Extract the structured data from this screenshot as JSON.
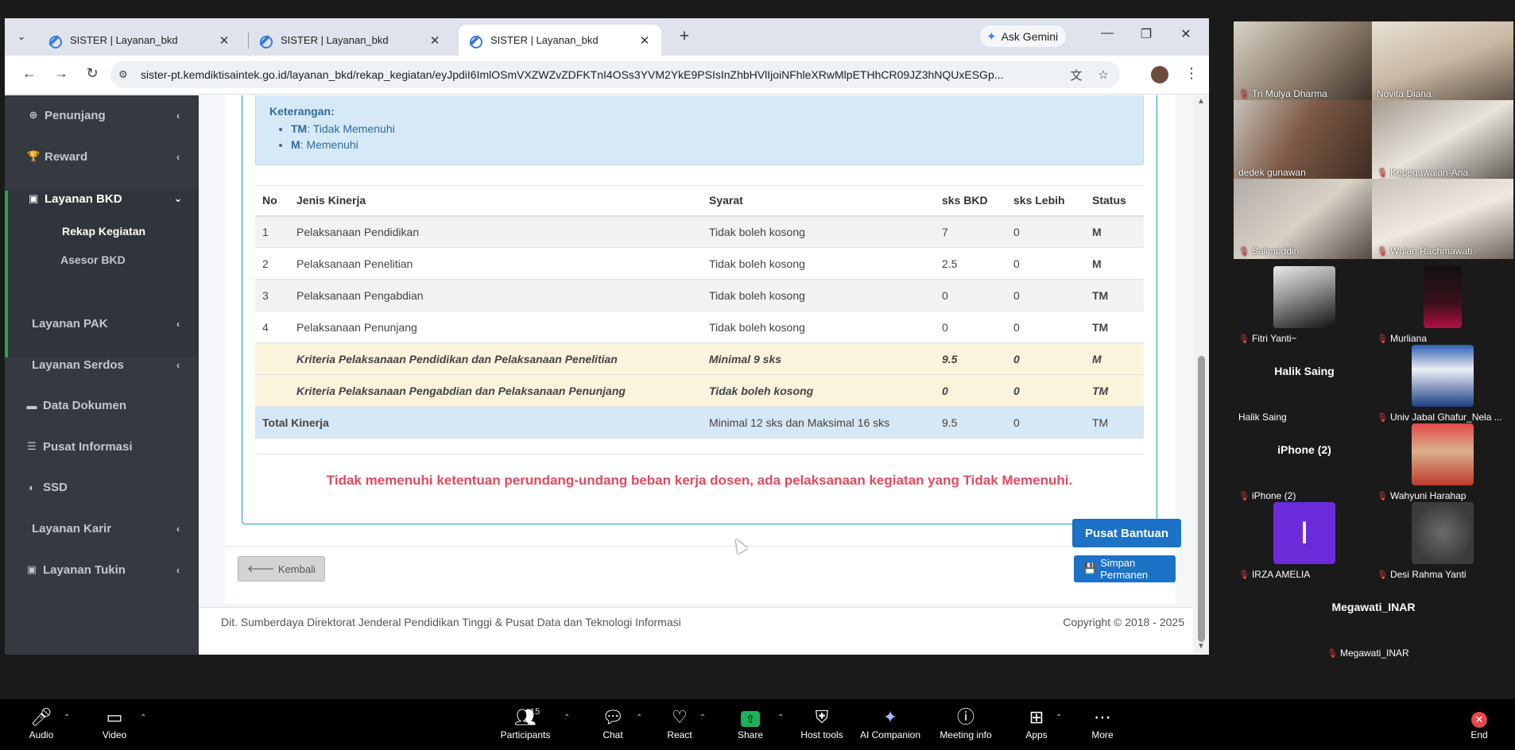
{
  "browser": {
    "tabs": [
      {
        "title": "SISTER | Layanan_bkd",
        "active": false
      },
      {
        "title": "SISTER | Layanan_bkd",
        "active": false
      },
      {
        "title": "SISTER | Layanan_bkd",
        "active": true
      }
    ],
    "ask_gemini": "Ask Gemini",
    "url": "sister-pt.kemdiktisaintek.go.id/layanan_bkd/rekap_kegiatan/eyJpdiI6ImlOSmVXZWZvZDFKTnI4OSs3YVM2YkE9PSIsInZhbHVlIjoiNFhleXRwMlpETHhCR09JZ3hNQUxESGp..."
  },
  "sidebar": {
    "items": [
      {
        "label": "Penunjang",
        "icon": "globe-icon",
        "chevron": "‹"
      },
      {
        "label": "Reward",
        "icon": "trophy-icon",
        "chevron": "‹"
      },
      {
        "label": "Layanan BKD",
        "icon": "briefcase-icon",
        "chevron": "⌄"
      },
      {
        "label": "Layanan PAK",
        "icon": "",
        "chevron": "‹"
      },
      {
        "label": "Layanan Serdos",
        "icon": "",
        "chevron": "‹"
      },
      {
        "label": "Data Dokumen",
        "icon": "folder-icon",
        "chevron": ""
      },
      {
        "label": "Pusat Informasi",
        "icon": "list-icon",
        "chevron": ""
      },
      {
        "label": "SSD",
        "icon": "circle-half-icon",
        "chevron": ""
      },
      {
        "label": "Layanan Karir",
        "icon": "",
        "chevron": "‹"
      },
      {
        "label": "Layanan Tukin",
        "icon": "briefcase-icon",
        "chevron": "‹"
      }
    ],
    "sub": [
      {
        "label": "Rekap Kegiatan"
      },
      {
        "label": "Asesor BKD"
      }
    ]
  },
  "keterangan": {
    "title": "Keterangan:",
    "items": [
      {
        "code": "TM",
        "desc": ": Tidak Memenuhi"
      },
      {
        "code": "M",
        "desc": ": Memenuhi"
      }
    ]
  },
  "table": {
    "headers": [
      "No",
      "Jenis Kinerja",
      "Syarat",
      "sks BKD",
      "sks Lebih",
      "Status"
    ],
    "rows": [
      {
        "no": "1",
        "jenis": "Pelaksanaan Pendidikan",
        "syarat": "Tidak boleh kosong",
        "bkd": "7",
        "lebih": "0",
        "status": "M"
      },
      {
        "no": "2",
        "jenis": "Pelaksanaan Penelitian",
        "syarat": "Tidak boleh kosong",
        "bkd": "2.5",
        "lebih": "0",
        "status": "M"
      },
      {
        "no": "3",
        "jenis": "Pelaksanaan Pengabdian",
        "syarat": "Tidak boleh kosong",
        "bkd": "0",
        "lebih": "0",
        "status": "TM"
      },
      {
        "no": "4",
        "jenis": "Pelaksanaan Penunjang",
        "syarat": "Tidak boleh kosong",
        "bkd": "0",
        "lebih": "0",
        "status": "TM"
      },
      {
        "no": "",
        "jenis": "Kriteria Pelaksanaan Pendidikan dan Pelaksanaan Penelitian",
        "syarat": "Minimal 9 sks",
        "bkd": "9.5",
        "lebih": "0",
        "status": "M"
      },
      {
        "no": "",
        "jenis": "Kriteria Pelaksanaan Pengabdian dan Pelaksanaan Penunjang",
        "syarat": "Tidak boleh kosong",
        "bkd": "0",
        "lebih": "0",
        "status": "TM"
      }
    ],
    "total": {
      "label": "Total Kinerja",
      "syarat": "Minimal 12 sks dan Maksimal 16 sks",
      "bkd": "9.5",
      "lebih": "0",
      "status": "TM"
    }
  },
  "warning": "Tidak memenuhi ketentuan perundang-undang beban kerja dosen, ada pelaksanaan kegiatan yang Tidak Memenuhi.",
  "buttons": {
    "back": "Kembali",
    "save": "Simpan Permanen",
    "help": "Pusat Bantuan"
  },
  "footer": {
    "left": "Dit. Sumberdaya Direktorat Jenderal Pendidikan Tinggi & Pusat Data dan Teknologi Informasi",
    "right": "Copyright © 2018 - 2025"
  },
  "participants": [
    {
      "name": "Tri Mulya Dharma",
      "muted": true,
      "type": "video"
    },
    {
      "name": "Novita Diana",
      "muted": false,
      "type": "video"
    },
    {
      "name": "dedek gunawan",
      "muted": false,
      "type": "video"
    },
    {
      "name": "Kepegawaian-Ana",
      "muted": true,
      "type": "video"
    },
    {
      "name": "Salimuddin",
      "muted": true,
      "type": "video"
    },
    {
      "name": "Wulan Rachmawati",
      "muted": true,
      "type": "video"
    },
    {
      "name": "Fitri Yanti~",
      "muted": true,
      "type": "photo"
    },
    {
      "name": "Murliana",
      "muted": true,
      "type": "photo"
    },
    {
      "name": "Halik Saing",
      "big": "Halik Saing",
      "muted": false,
      "type": "name"
    },
    {
      "name": "Univ Jabal Ghafur_Nela ...",
      "muted": true,
      "type": "photo"
    },
    {
      "name": "iPhone (2)",
      "big": "iPhone (2)",
      "muted": true,
      "type": "name"
    },
    {
      "name": "Wahyuni Harahap",
      "muted": true,
      "type": "photo"
    },
    {
      "name": "IRZA AMELIA",
      "letter": "I",
      "muted": true,
      "type": "letter"
    },
    {
      "name": "Desi Rahma Yanti",
      "muted": true,
      "type": "photo"
    },
    {
      "name": "Megawati_INAR",
      "big": "Megawati_INAR",
      "muted": true,
      "type": "name"
    }
  ],
  "zoom_toolbar": {
    "audio": "Audio",
    "video": "Video",
    "participants": "Participants",
    "participants_count": "15",
    "chat": "Chat",
    "react": "React",
    "share": "Share",
    "host_tools": "Host tools",
    "ai_companion": "AI Companion",
    "meeting_info": "Meeting info",
    "apps": "Apps",
    "more": "More",
    "end": "End"
  },
  "colors": {
    "sidebar_bg": "#343a40",
    "active_green": "#28a745",
    "status_green": "#1a9b2a",
    "status_red": "#e8201f",
    "primary_blue": "#1b72c6",
    "warning_text": "#e24a5f"
  }
}
